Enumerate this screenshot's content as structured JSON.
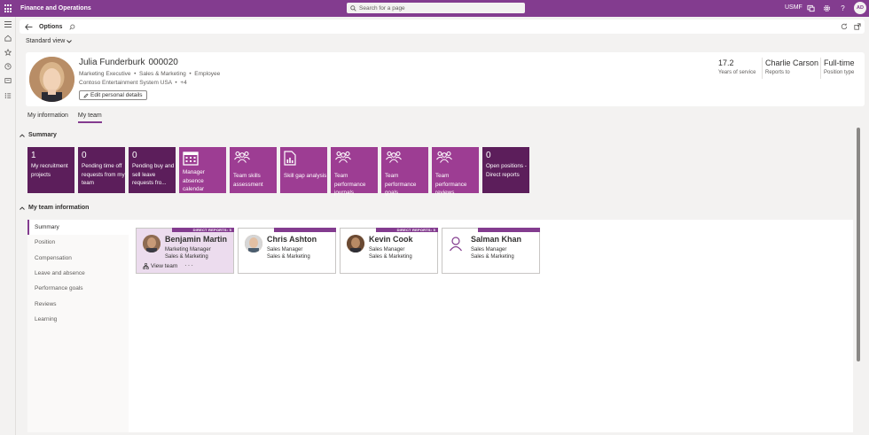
{
  "app": {
    "title": "Finance and Operations",
    "search_placeholder": "Search for a page",
    "company": "USMF",
    "user_initials": "AD",
    "accent_color": "#833c8f"
  },
  "actionbar": {
    "title": "Options"
  },
  "view": {
    "label": "Standard view"
  },
  "employee": {
    "name": "Julia Funderburk",
    "id": "000020",
    "title": "Marketing Executive",
    "department": "Sales & Marketing",
    "type": "Employee",
    "legal_entity": "Contoso Entertainment System USA",
    "extra": "+4",
    "edit_label": "Edit personal details",
    "stats": [
      {
        "value": "17.2",
        "label": "Years of service"
      },
      {
        "value": "Charlie Carson",
        "label": "Reports to"
      },
      {
        "value": "Full-time",
        "label": "Position type"
      }
    ]
  },
  "tabs": [
    {
      "label": "My information",
      "active": false
    },
    {
      "label": "My team",
      "active": true
    }
  ],
  "summary": {
    "header": "Summary",
    "tiles": [
      {
        "count": "1",
        "label": "My recruitment projects",
        "style": "dark"
      },
      {
        "count": "0",
        "label": "Pending time off requests from my team",
        "style": "dark"
      },
      {
        "count": "0",
        "label": "Pending buy and sell leave requests fro...",
        "style": "dark"
      },
      {
        "icon": "calendar-icon",
        "label": "Manager absence calendar",
        "style": "light"
      },
      {
        "icon": "team-icon",
        "label": "Team skills assessment",
        "style": "light"
      },
      {
        "icon": "report-icon",
        "label": "Skill gap analysis",
        "style": "light"
      },
      {
        "icon": "team-icon",
        "label": "Team performance journals",
        "style": "light"
      },
      {
        "icon": "team-icon",
        "label": "Team performance goals",
        "style": "light"
      },
      {
        "icon": "team-icon",
        "label": "Team performance reviews",
        "style": "light"
      },
      {
        "count": "0",
        "label": "Open positions - Direct reports",
        "style": "dark"
      }
    ]
  },
  "team_info": {
    "header": "My team information",
    "nav": [
      "Summary",
      "Position",
      "Compensation",
      "Leave and absence",
      "Performance goals",
      "Reviews",
      "Learning"
    ],
    "members": [
      {
        "name": "Benjamin Martin",
        "title": "Marketing Manager",
        "department": "Sales & Marketing",
        "badge": "DIRECT REPORTS: 5",
        "link": "View team",
        "more": "···",
        "selected": true
      },
      {
        "name": "Chris Ashton",
        "title": "Sales Manager",
        "department": "Sales & Marketing",
        "badge": "",
        "selected": false
      },
      {
        "name": "Kevin Cook",
        "title": "Sales Manager",
        "department": "Sales & Marketing",
        "badge": "DIRECT REPORTS: 5",
        "selected": false
      },
      {
        "name": "Salman Khan",
        "title": "Sales Manager",
        "department": "Sales & Marketing",
        "badge": "",
        "selected": false
      }
    ]
  }
}
